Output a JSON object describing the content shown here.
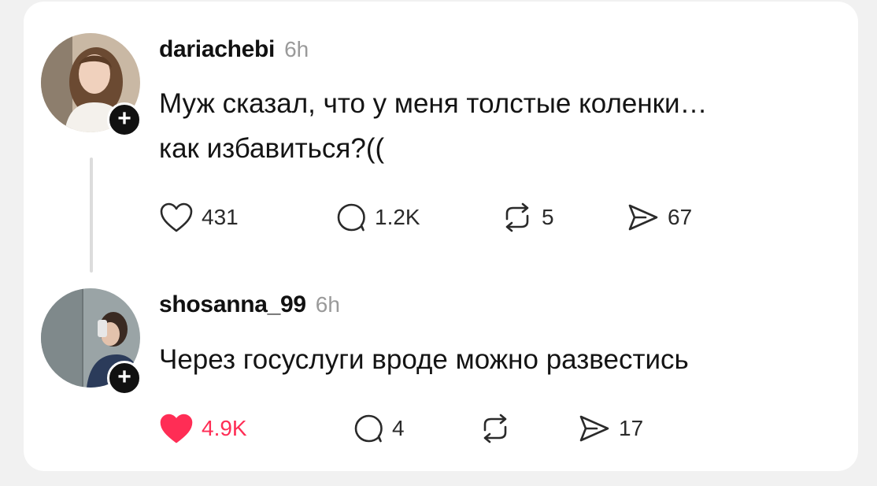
{
  "posts": [
    {
      "username": "dariachebi",
      "time": "6h",
      "text_lines": [
        "Муж сказал, что у меня толстые коленки…",
        "как избавиться?(("
      ],
      "likes": "431",
      "replies": "1.2K",
      "reposts": "5",
      "shares": "67",
      "liked": false
    },
    {
      "username": "shosanna_99",
      "time": "6h",
      "text_lines": [
        "Через госуслуги вроде можно развестись"
      ],
      "likes": "4.9K",
      "replies": "4",
      "reposts": "",
      "shares": "17",
      "liked": true
    }
  ],
  "colors": {
    "like_active": "#ff2d55",
    "icon": "#2a2a2a",
    "muted": "#9a9a9a"
  },
  "icons": {
    "like": "heart-icon",
    "reply": "comment-bubble-icon",
    "repost": "repost-arrows-icon",
    "share": "send-icon",
    "follow": "plus-icon"
  }
}
